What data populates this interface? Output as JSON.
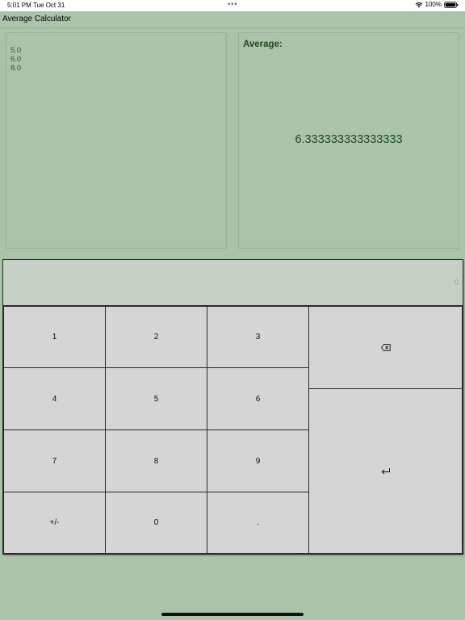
{
  "status_bar": {
    "time": "5:01 PM",
    "date": "Tue Oct 31",
    "dots": "•••",
    "battery_text": "100%",
    "icons": [
      "wifi-icon",
      "battery-icon"
    ]
  },
  "app": {
    "title": "Average Calculator"
  },
  "values": [
    "5.0",
    "6.0",
    "8.0"
  ],
  "average": {
    "label": "Average:",
    "value": "6.333333333333333"
  },
  "keypad": {
    "display_value": "0",
    "keys": {
      "k1": "1",
      "k2": "2",
      "k3": "3",
      "k4": "4",
      "k5": "5",
      "k6": "6",
      "k7": "7",
      "k8": "8",
      "k9": "9",
      "sign": "+/-",
      "k0": "0",
      "dot": "."
    },
    "icons": {
      "backspace": "backspace-icon",
      "enter": "return-icon"
    }
  },
  "colors": {
    "background": "#aac4aa",
    "text_green": "#1e4a1e",
    "key_bg": "#d5d5d5",
    "display_bg": "#c6cfc6"
  }
}
